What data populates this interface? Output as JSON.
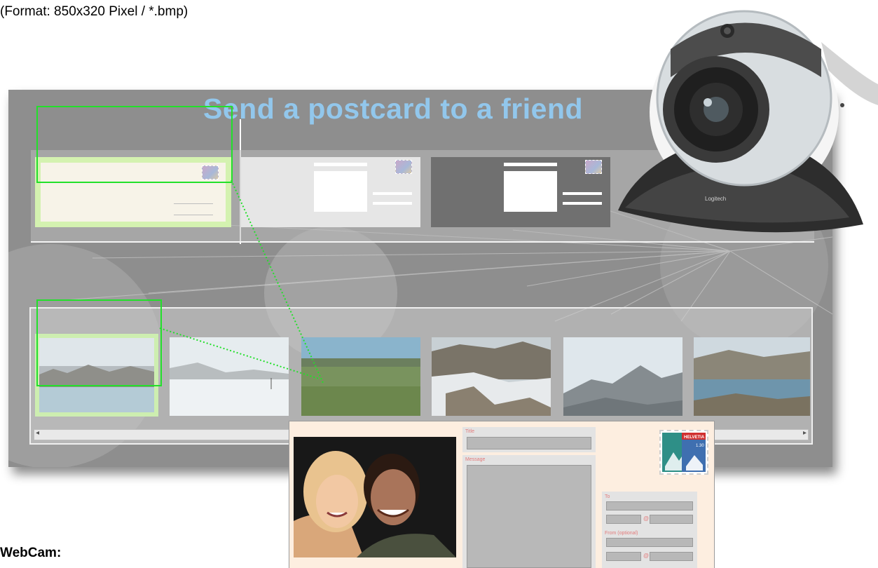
{
  "caption": {
    "format_note": "(Format: 850x320 Pixel / *.bmp)",
    "webcam_label": "WebCam:"
  },
  "kiosk": {
    "title": "Send a postcard to a friend",
    "title_color": "#92c7ec",
    "background_color": "#8e8e8e",
    "selection_color": "#22e02a",
    "template_cards": [
      "light cream template (selected)",
      "light gray template",
      "dark gray template"
    ],
    "photo_thumbnails": [
      "lake panorama (selected)",
      "misty lake with sailboat",
      "green meadow",
      "snowy rocky slope",
      "mountain peaks",
      "lake view"
    ],
    "scrollbar": {
      "left_arrow": "◂",
      "right_arrow": "▸"
    }
  },
  "webcam": {
    "brand": "Logitech"
  },
  "postcard": {
    "title_label": "Title",
    "message_label": "Message",
    "to_label": "To",
    "from_label": "From (optional)",
    "at_symbol": "@",
    "stamp_text": "HELVETIA",
    "stamp_value": "1.30",
    "background_color": "#fdeee0",
    "label_color": "#e37b7b"
  }
}
